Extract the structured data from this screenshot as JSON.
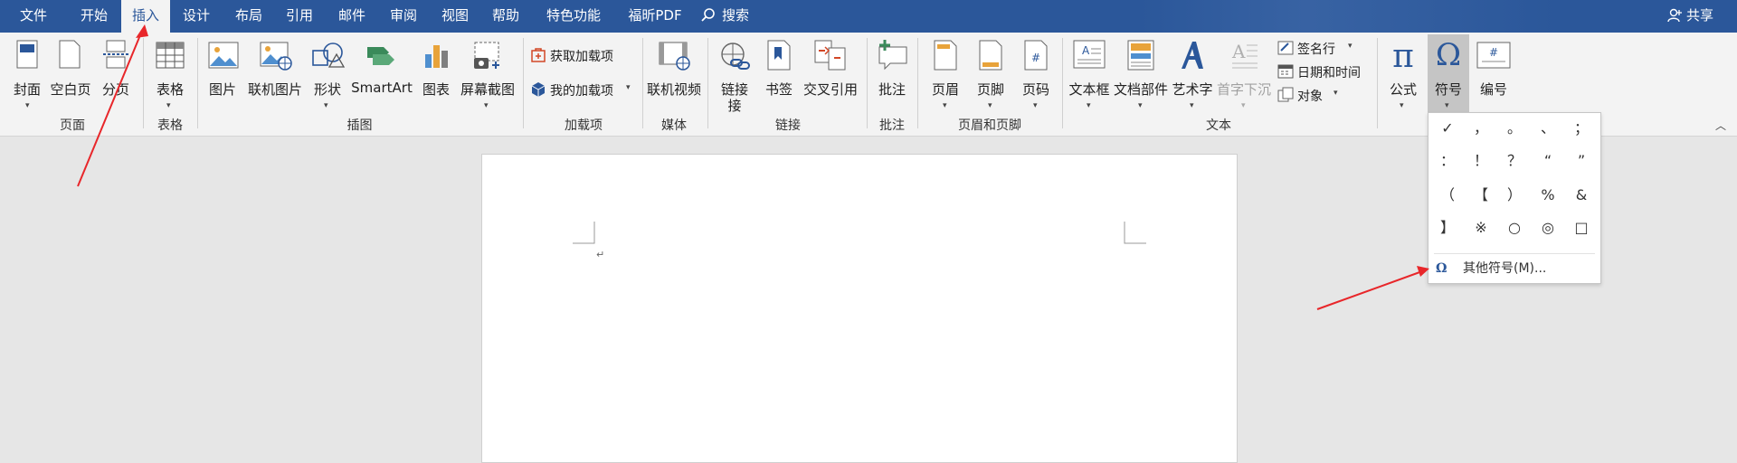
{
  "tabs": [
    "文件",
    "开始",
    "插入",
    "设计",
    "布局",
    "引用",
    "邮件",
    "审阅",
    "视图",
    "帮助",
    "特色功能",
    "福昕PDF"
  ],
  "search_label": "搜索",
  "share_label": "共享",
  "groups": {
    "page": {
      "label": "页面",
      "buttons": [
        "封面",
        "空白页",
        "分页"
      ]
    },
    "table": {
      "label": "表格",
      "buttons": [
        "表格"
      ]
    },
    "illustrations": {
      "label": "插图",
      "buttons": [
        "图片",
        "联机图片",
        "形状",
        "SmartArt",
        "图表",
        "屏幕截图"
      ]
    },
    "addins": {
      "label": "加载项",
      "buttons": [
        "获取加载项",
        "我的加载项"
      ]
    },
    "media": {
      "label": "媒体",
      "buttons": [
        "联机视频"
      ]
    },
    "links": {
      "label": "链接",
      "buttons": [
        "链接",
        "书签",
        "交叉引用"
      ],
      "link_line2": "接"
    },
    "comments": {
      "label": "批注",
      "buttons": [
        "批注"
      ]
    },
    "header_footer": {
      "label": "页眉和页脚",
      "buttons": [
        "页眉",
        "页脚",
        "页码"
      ]
    },
    "text": {
      "label": "文本",
      "buttons": [
        "文本框",
        "文档部件",
        "艺术字",
        "首字下沉"
      ],
      "small": [
        "签名行",
        "日期和时间",
        "对象"
      ]
    },
    "symbols": {
      "buttons": [
        "公式",
        "符号",
        "编号"
      ]
    }
  },
  "symbols_grid": [
    "✓",
    "，",
    "。",
    "、",
    "；",
    "：",
    "！",
    "？",
    "“",
    "”",
    "（",
    "【",
    "）",
    "%",
    "&",
    "】",
    "※",
    "○",
    "◎",
    "□"
  ],
  "more_symbols": "其他符号(M)...",
  "paragraph_mark": "↵",
  "colors": {
    "ribbon_blue": "#2b579a",
    "arrow_red": "#e8262a"
  }
}
